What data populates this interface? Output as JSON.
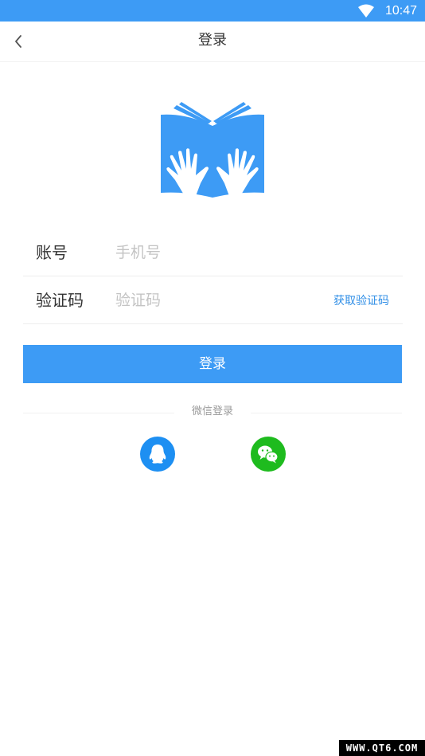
{
  "status_bar": {
    "time": "10:47",
    "color": "#3d9bf5"
  },
  "nav": {
    "title": "登录",
    "back_icon": "chevron-left-icon"
  },
  "logo": {
    "icon": "book-hands-logo",
    "color": "#3d9bf5"
  },
  "form": {
    "account_label": "账号",
    "account_placeholder": "手机号",
    "code_label": "验证码",
    "code_placeholder": "验证码",
    "get_code_label": "获取验证码"
  },
  "login_button": {
    "label": "登录"
  },
  "social": {
    "divider_text": "微信登录",
    "qq_icon": "qq-penguin-icon",
    "qq_color": "#1d8ff2",
    "wechat_icon": "wechat-icon",
    "wechat_color": "#1ebb1e"
  },
  "watermark": "WWW.QT6.COM"
}
